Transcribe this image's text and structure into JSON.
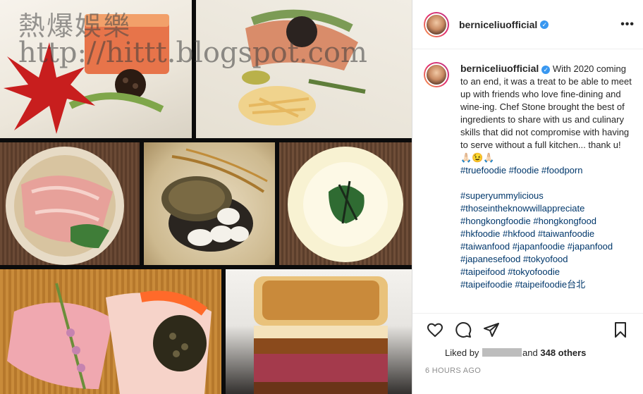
{
  "watermark": {
    "line1": "熱爆娛樂",
    "line2": "http://hittt.blogspot.com"
  },
  "post": {
    "username": "berniceliuofficial",
    "verified_symbol": "✓",
    "more_symbol": "•••",
    "caption": "With 2020 coming to an end, it was a treat to be able to meet up with friends who love fine-dining and wine-ing. Chef Stone brought the best of ingredients to share with us and culinary skills that did not compromise with having to serve without a full kitchen... thank u! 🙏🏻😉🙏🏻",
    "hashtags_line1": "#truefoodie #foodie #foodporn",
    "hashtags": [
      "#superyummylicious",
      "#thoseintheknowwillappreciate",
      "#hongkongfoodie #hongkongfood",
      "#hkfoodie #hkfood #taiwanfoodie",
      "#taiwanfood #japanfoodie #japanfood",
      "#japanesefood #tokyofood",
      "#taipeifood #tokyofoodie",
      "#taipeifoodie #taipeifoodie台北"
    ],
    "likes_prefix": "Liked by",
    "likes_and": "and",
    "likes_count": "348 others",
    "timestamp": "6 HOURS AGO"
  },
  "icons": {
    "like": "heart-icon",
    "comment": "comment-icon",
    "share": "share-icon",
    "save": "bookmark-icon"
  }
}
